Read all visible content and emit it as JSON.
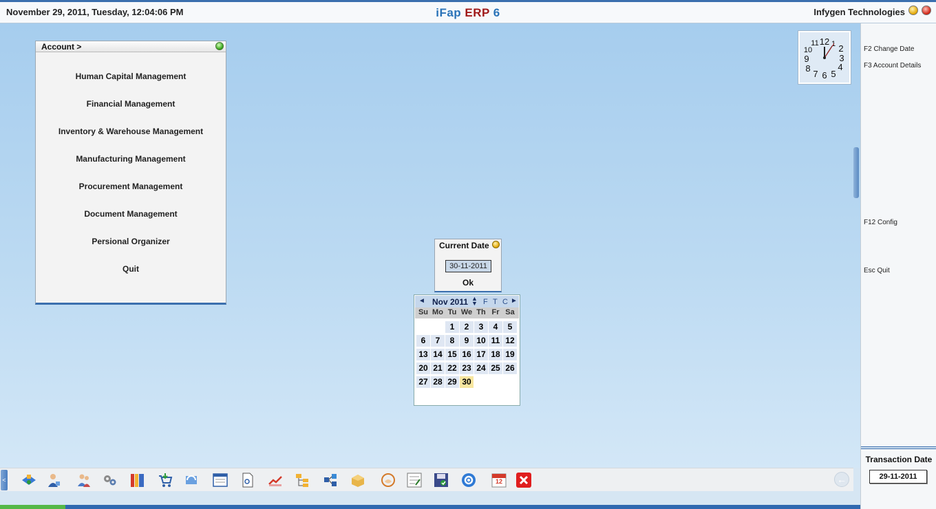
{
  "header": {
    "datetime": "November  29, 2011, Tuesday, 12:04:06 PM",
    "title_part1": "iFap",
    "title_part2": "ERP",
    "title_part3": "6",
    "company": "Infygen Technologies"
  },
  "account_panel": {
    "title": "Account >",
    "items": [
      "Human Capital Management",
      "Financial Management",
      "Inventory & Warehouse Management",
      "Manufacturing Management",
      "Procurement Management",
      "Document Management",
      "Persional Organizer",
      "Quit"
    ]
  },
  "clock": {
    "time": "12:04"
  },
  "shortcuts": {
    "change_date": "F2 Change Date",
    "account_details": "F3 Account Details",
    "config": "F12 Config",
    "quit": "Esc Quit"
  },
  "transaction": {
    "label": "Transaction Date",
    "value": "29-11-2011"
  },
  "date_dialog": {
    "title": "Current Date",
    "value": "30-11-2011",
    "ok_label": "Ok"
  },
  "calendar": {
    "prev": "◄",
    "month_label": "Nov 2011",
    "spin": "▲▼",
    "options": [
      "F",
      "T",
      "C"
    ],
    "next": "►",
    "weekdays": [
      "Su",
      "Mo",
      "Tu",
      "We",
      "Th",
      "Fr",
      "Sa"
    ],
    "days": [
      1,
      2,
      3,
      4,
      5,
      6,
      7,
      8,
      9,
      10,
      11,
      12,
      13,
      14,
      15,
      16,
      17,
      18,
      19,
      20,
      21,
      22,
      23,
      24,
      25,
      26,
      27,
      28,
      29,
      30
    ],
    "first_weekday": 2,
    "selected": 30
  },
  "toolbar": {
    "left_arrow": "<",
    "icons": [
      "network-icon",
      "user-icon",
      "people-icon",
      "gears-icon",
      "books-icon",
      "cart-icon",
      "sync-icon",
      "window-icon",
      "document-icon",
      "chart-icon",
      "tree-icon",
      "flow-icon",
      "box-icon",
      "hand-icon",
      "checklist-icon",
      "save-icon",
      "settings-icon",
      "calendar-icon",
      "exit-icon"
    ],
    "calendar_icon_text": "12",
    "back": "←"
  },
  "colors": {
    "accent": "#3b6fae",
    "title_blue": "#2a73b8",
    "title_red": "#a01818",
    "today": "#f7e6a0"
  }
}
